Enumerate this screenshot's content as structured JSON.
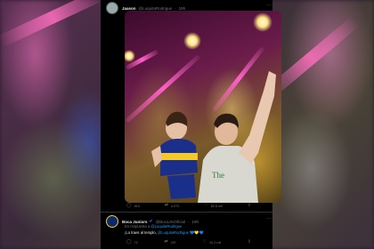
{
  "original_tweet": {
    "author_name": "Jaason",
    "author_handle": "@LuquitaRodrigue",
    "time": "19h",
    "actions": {
      "reply_count": "810",
      "retweet_count": "4.970",
      "like_count": "82.6 mil"
    }
  },
  "reply_tweet": {
    "author_name": "Boca Juniors",
    "author_handle": "@BocaJrsOficial",
    "time": "19h",
    "in_reply_prefix": "En respuesta a",
    "in_reply_handle": "@LuquitaRodrigue",
    "text": "¡Lo traes al templo,",
    "text_mention": "@LuquitaRodrigue",
    "emoji_hearts": "💙💛💙",
    "actions": {
      "reply_count": "72",
      "retweet_count": "297",
      "like_count": "10.2 mil"
    }
  },
  "colors": {
    "tweet_bg": "#000000",
    "link": "#1d9bf0",
    "secondary_text": "#71767b",
    "beam_pink": "#ff5fc8"
  },
  "icons": {
    "reply": "speech-bubble-icon",
    "retweet": "retweet-icon",
    "like": "heart-icon",
    "share": "share-icon",
    "more": "more-icon"
  }
}
